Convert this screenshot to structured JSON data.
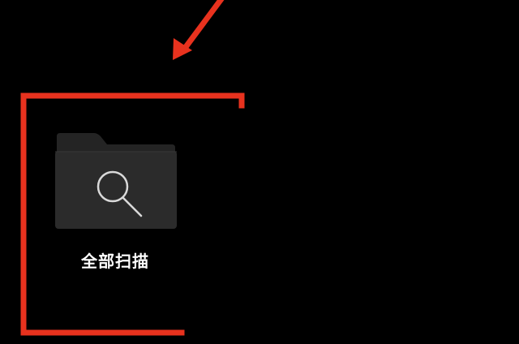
{
  "scan_all": {
    "label": "全部扫描",
    "icon": "folder-search-icon"
  },
  "colors": {
    "background": "#000000",
    "annotation_red": "#e8321e",
    "folder_fill": "#2b2b2b",
    "folder_tab": "#242424",
    "icon_stroke": "#d9d9d9",
    "label_text": "#ffffff"
  }
}
